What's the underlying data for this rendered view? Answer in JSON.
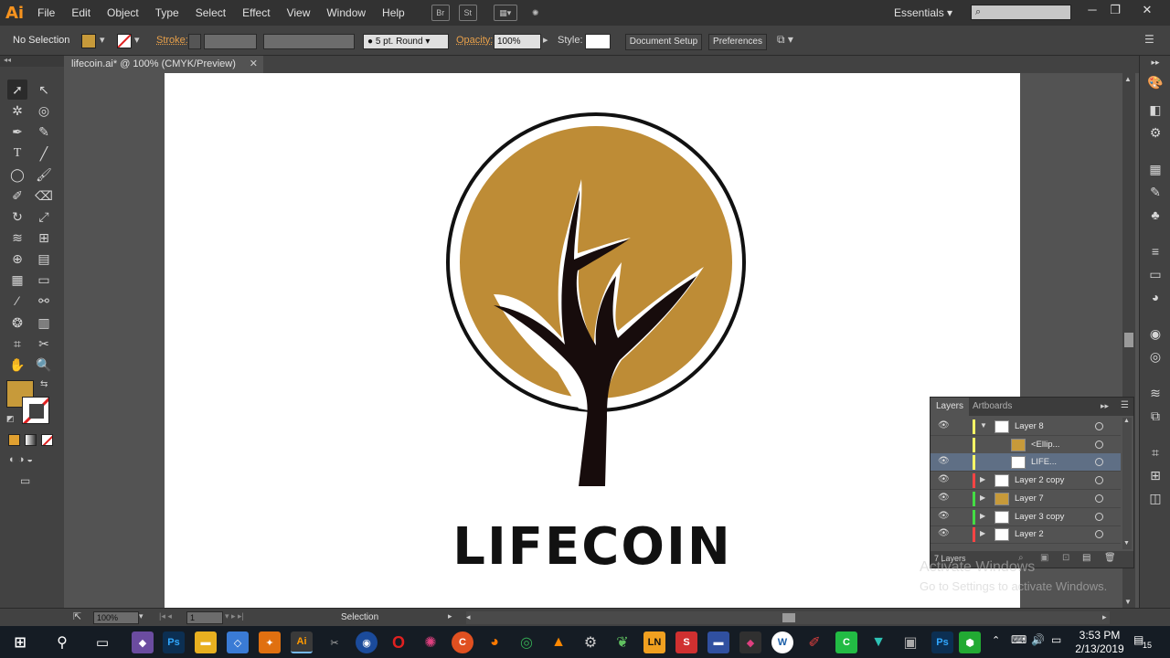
{
  "app": {
    "logo": "Ai"
  },
  "menu": [
    "File",
    "Edit",
    "Object",
    "Type",
    "Select",
    "Effect",
    "View",
    "Window",
    "Help"
  ],
  "menubar_icons": {
    "br": "Br",
    "st": "St"
  },
  "workspace": "Essentials",
  "control_bar": {
    "selection_label": "No Selection",
    "stroke_label": "Stroke:",
    "stroke_weight": "",
    "brush": "5 pt. Round",
    "opacity_label": "Opacity:",
    "opacity_value": "100%",
    "style_label": "Style:",
    "doc_setup": "Document Setup",
    "preferences": "Preferences"
  },
  "document_tab": {
    "title": "lifecoin.ai* @ 100% (CMYK/Preview)"
  },
  "artwork": {
    "logo_text": "LIFECOIN",
    "fill_color": "#be8c36",
    "ink_color": "#170c0c"
  },
  "colors": {
    "fill": "#c79a3a",
    "accent_orange": "#f7931e"
  },
  "layers_panel": {
    "tabs": [
      "Layers",
      "Artboards"
    ],
    "rows": [
      {
        "name": "Layer 8",
        "color": "#ffff66",
        "expanded": true,
        "indent": 0,
        "thumb": "line"
      },
      {
        "name": "<Ellip...",
        "color": "#ffff66",
        "indent": 1,
        "thumb": "gold"
      },
      {
        "name": "LIFE...",
        "color": "#ffff66",
        "indent": 1,
        "thumb": "line",
        "selected": true
      },
      {
        "name": "Layer 2 copy",
        "color": "#ff4444",
        "indent": 0,
        "thumb": "tree"
      },
      {
        "name": "Layer 7",
        "color": "#44dd44",
        "indent": 0,
        "thumb": "goldtree"
      },
      {
        "name": "Layer 3 copy",
        "color": "#44dd44",
        "indent": 0,
        "thumb": "circle"
      },
      {
        "name": "Layer 2",
        "color": "#ff4444",
        "indent": 0,
        "thumb": "tree"
      }
    ],
    "count": "7 Layers"
  },
  "watermark": {
    "line1": "Activate Windows",
    "line2": "Go to Settings to activate Windows."
  },
  "status_bar": {
    "zoom": "100%",
    "artboard": "1",
    "tool": "Selection"
  },
  "taskbar": {
    "time": "3:53 PM",
    "date": "2/13/2019",
    "notifications": "15",
    "ps_label": "Ps",
    "ai_label": "Ai",
    "ln_label": "LN"
  }
}
